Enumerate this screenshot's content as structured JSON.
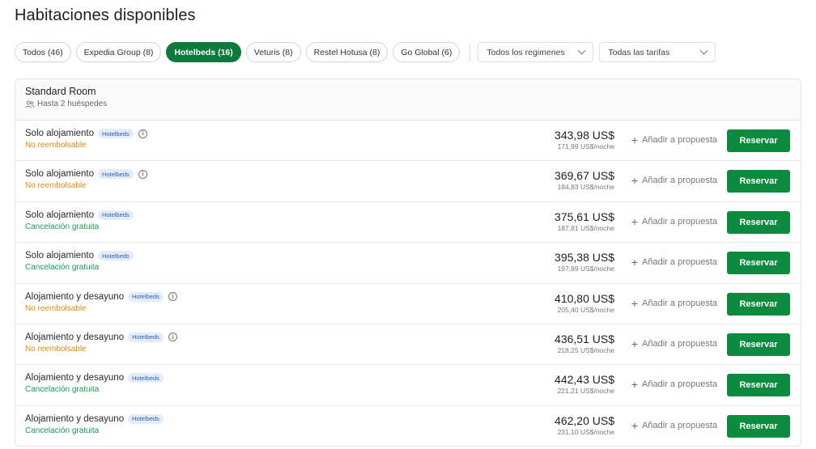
{
  "page_title": "Habitaciones disponibles",
  "filters": {
    "providers": [
      {
        "label": "Todos (46)",
        "active": false
      },
      {
        "label": "Expedia Group (8)",
        "active": false
      },
      {
        "label": "Hotelbeds (16)",
        "active": true
      },
      {
        "label": "Veturis (8)",
        "active": false
      },
      {
        "label": "Restel Hotusa (8)",
        "active": false
      },
      {
        "label": "Go Global (6)",
        "active": false
      }
    ],
    "regimen_select": "Todos los regimenes",
    "tarifas_select": "Todas las tarifas"
  },
  "room": {
    "name": "Standard Room",
    "guests": "Hasta 2 huéspedes",
    "rates": [
      {
        "board": "Solo alojamiento",
        "provider": "Hotelbeds",
        "info": true,
        "policy": "No reembolsable",
        "refundable": false,
        "total": "343,98 US$",
        "per_night": "171,99 US$/noche"
      },
      {
        "board": "Solo alojamiento",
        "provider": "Hotelbeds",
        "info": true,
        "policy": "No reembolsable",
        "refundable": false,
        "total": "369,67 US$",
        "per_night": "184,83 US$/noche"
      },
      {
        "board": "Solo alojamiento",
        "provider": "Hotelbeds",
        "info": false,
        "policy": "Cancelación gratuita",
        "refundable": true,
        "total": "375,61 US$",
        "per_night": "187,81 US$/noche"
      },
      {
        "board": "Solo alojamiento",
        "provider": "Hotelbeds",
        "info": false,
        "policy": "Cancelación gratuita",
        "refundable": true,
        "total": "395,38 US$",
        "per_night": "197,69 US$/noche"
      },
      {
        "board": "Alojamiento y desayuno",
        "provider": "Hotelbeds",
        "info": true,
        "policy": "No reembolsable",
        "refundable": false,
        "total": "410,80 US$",
        "per_night": "205,40 US$/noche"
      },
      {
        "board": "Alojamiento y desayuno",
        "provider": "Hotelbeds",
        "info": true,
        "policy": "No reembolsable",
        "refundable": false,
        "total": "436,51 US$",
        "per_night": "218,25 US$/noche"
      },
      {
        "board": "Alojamiento y desayuno",
        "provider": "Hotelbeds",
        "info": false,
        "policy": "Cancelación gratuita",
        "refundable": true,
        "total": "442,43 US$",
        "per_night": "221,21 US$/noche"
      },
      {
        "board": "Alojamiento y desayuno",
        "provider": "Hotelbeds",
        "info": false,
        "policy": "Cancelación gratuita",
        "refundable": true,
        "total": "462,20 US$",
        "per_night": "231,10 US$/noche"
      }
    ]
  },
  "actions": {
    "add_label": "Añadir a propuesta",
    "reserve_label": "Reservar"
  },
  "colors": {
    "primary": "#0c8a3e",
    "non_refundable": "#e08a12",
    "free_cancellation": "#1a9a55",
    "badge_bg": "#e3ecfb",
    "badge_text": "#2f5cb8"
  },
  "icons": {
    "guests": "users-icon",
    "info": "info-icon",
    "add": "plus-icon",
    "select": "chevron-down-icon"
  }
}
